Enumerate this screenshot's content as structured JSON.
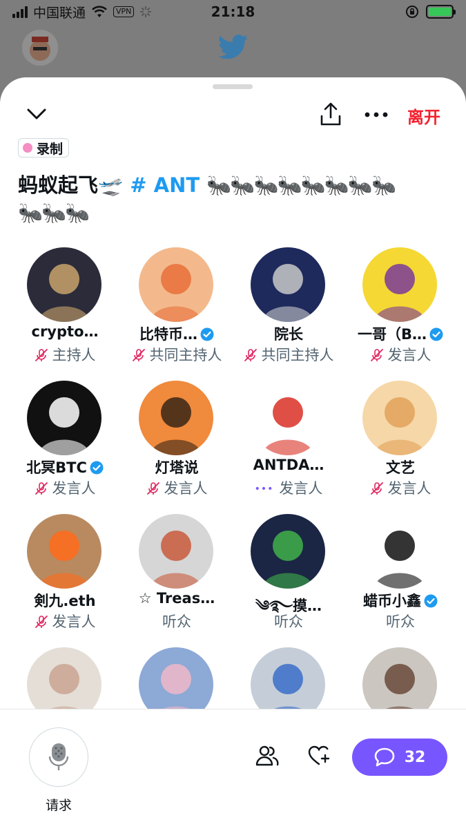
{
  "status_bar": {
    "carrier": "中国联通",
    "vpn": "VPN",
    "time": "21:18"
  },
  "space": {
    "leave_label": "离开",
    "recording_label": "录制",
    "title_text": "蚂蚁起飞",
    "title_emoji": "🛫",
    "hashtag": "# ANT",
    "title_ants_line1": "🐜🐜🐜🐜🐜🐜🐜🐜",
    "title_ants_line2": "🐜🐜🐜"
  },
  "participants": [
    {
      "name": "crypto…",
      "verified": false,
      "role": "主持人",
      "mic": "muted",
      "color": "#2b2b3a",
      "accent": "#c9a36b"
    },
    {
      "name": "比特币…",
      "verified": true,
      "role": "共同主持人",
      "mic": "muted",
      "color": "#f3b98c",
      "accent": "#e8703a"
    },
    {
      "name": "院长",
      "verified": false,
      "role": "共同主持人",
      "mic": "muted",
      "color": "#1e2a5c",
      "accent": "#c9c9c9"
    },
    {
      "name": "一哥（B…",
      "verified": true,
      "role": "发言人",
      "mic": "muted",
      "color": "#f5d833",
      "accent": "#7a3b9a"
    },
    {
      "name": "北冥BTC",
      "verified": true,
      "role": "发言人",
      "mic": "muted",
      "color": "#111111",
      "accent": "#ffffff"
    },
    {
      "name": "灯塔说",
      "verified": false,
      "role": "发言人",
      "mic": "muted",
      "color": "#f08a3c",
      "accent": "#3a2416"
    },
    {
      "name": "ANTDA…",
      "verified": false,
      "role": "发言人",
      "mic": "speaking",
      "color": "#ffffff",
      "accent": "#d93025"
    },
    {
      "name": "文艺",
      "verified": false,
      "role": "发言人",
      "mic": "muted",
      "color": "#f6d7a7",
      "accent": "#e2a25a"
    },
    {
      "name": "剣九.eth",
      "verified": false,
      "role": "发言人",
      "mic": "muted",
      "color": "#b98a60",
      "accent": "#ff6a1a"
    },
    {
      "name": "☆ Treas…",
      "verified": false,
      "role": "听众",
      "mic": "none",
      "color": "#d6d6d6",
      "accent": "#c85b3c"
    },
    {
      "name": "༄࿐摸…",
      "verified": false,
      "role": "听众",
      "mic": "none",
      "color": "#1b2544",
      "accent": "#3fb04a"
    },
    {
      "name": "蜡币小鑫",
      "verified": true,
      "role": "听众",
      "mic": "none",
      "color": "#ffffff",
      "accent": "#111111"
    },
    {
      "name": "",
      "verified": false,
      "role": "",
      "mic": "none",
      "color": "#e4ded6",
      "accent": "#caa592"
    },
    {
      "name": "",
      "verified": false,
      "role": "",
      "mic": "none",
      "color": "#8da9d6",
      "accent": "#f0b8c8"
    },
    {
      "name": "",
      "verified": false,
      "role": "",
      "mic": "none",
      "color": "#c5ced8",
      "accent": "#3a6ec9"
    },
    {
      "name": "",
      "verified": false,
      "role": "",
      "mic": "none",
      "color": "#cbc6c0",
      "accent": "#6a4a3a"
    }
  ],
  "bottom_bar": {
    "request_label": "请求",
    "chat_count": "32"
  },
  "colors": {
    "accent_purple": "#7856ff",
    "twitter_blue": "#1d9bf0",
    "leave_red": "#f4212e",
    "muted_pink": "#e0245e"
  }
}
